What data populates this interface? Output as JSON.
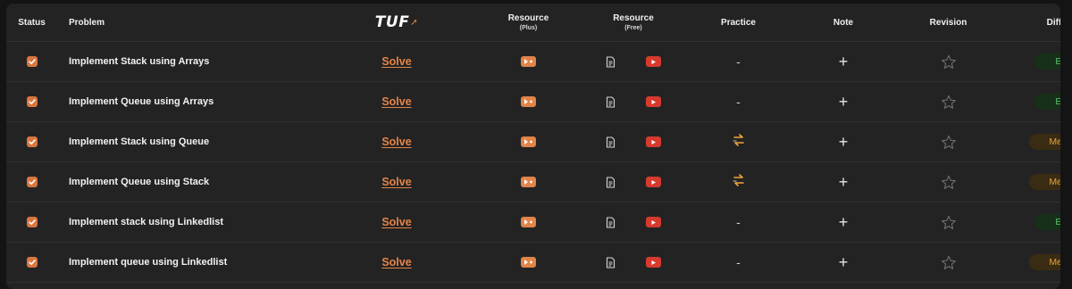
{
  "header": {
    "status": "Status",
    "problem": "Problem",
    "logo_text": "TUF",
    "resource_plus": "Resource",
    "resource_plus_sub": "(Plus)",
    "resource_free": "Resource",
    "resource_free_sub": "(Free)",
    "practice": "Practice",
    "note": "Note",
    "revision": "Revision",
    "difficulty": "Difficulty"
  },
  "rows": [
    {
      "checked": true,
      "problem": "Implement Stack using Arrays",
      "solve": "Solve",
      "practice": "-",
      "note": "+",
      "difficulty": "Easy"
    },
    {
      "checked": true,
      "problem": "Implement Queue using Arrays",
      "solve": "Solve",
      "practice": "-",
      "note": "+",
      "difficulty": "Easy"
    },
    {
      "checked": true,
      "problem": "Implement Stack using Queue",
      "solve": "Solve",
      "practice": "practice-link-icon",
      "note": "+",
      "difficulty": "Medium"
    },
    {
      "checked": true,
      "problem": "Implement Queue using Stack",
      "solve": "Solve",
      "practice": "practice-link-icon",
      "note": "+",
      "difficulty": "Medium"
    },
    {
      "checked": true,
      "problem": "Implement stack using Linkedlist",
      "solve": "Solve",
      "practice": "-",
      "note": "+",
      "difficulty": "Easy"
    },
    {
      "checked": true,
      "problem": "Implement queue using Linkedlist",
      "solve": "Solve",
      "practice": "-",
      "note": "+",
      "difficulty": "Medium"
    }
  ],
  "colors": {
    "accent": "#e58449",
    "easy_text": "#58c46a",
    "medium_text": "#e6a23c",
    "youtube": "#d63a2e"
  }
}
